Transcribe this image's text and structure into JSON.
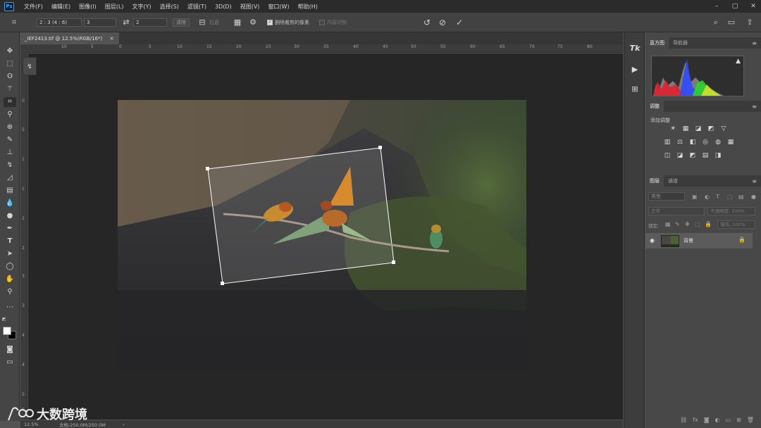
{
  "app": {
    "logo": "Ps"
  },
  "menu": [
    "文件(F)",
    "编辑(E)",
    "图像(I)",
    "图层(L)",
    "文字(Y)",
    "选择(S)",
    "滤镜(T)",
    "3D(D)",
    "视图(V)",
    "窗口(W)",
    "帮助(H)"
  ],
  "window_controls": {
    "minimize": "–",
    "restore": "▢",
    "close": "✕"
  },
  "options": {
    "ratio_value": "2 : 3 (4 : 6)",
    "width_value": "3",
    "height_value": "2",
    "clear_label": "清除",
    "straighten_label": "拉直",
    "delete_cropped_label": "删除裁剪的像素",
    "content_aware_label": "内容识别"
  },
  "document": {
    "tab_title": "_IEF2413.tif @ 12.5%(RGB/16*)",
    "tab_close": "×"
  },
  "rulers": {
    "h_ticks": [
      "10",
      "5",
      "0",
      "5",
      "10",
      "15",
      "20",
      "25",
      "30",
      "35",
      "40",
      "45",
      "50",
      "55",
      "60",
      "65",
      "70",
      "75",
      "80"
    ],
    "v_ticks": [
      "0",
      "5",
      "1",
      "1",
      "2",
      "2",
      "3",
      "3",
      "4",
      "4",
      "5",
      "5"
    ]
  },
  "status": {
    "zoom": "12.5%",
    "doc_size": "文档:250.0M/250.0M",
    "arrow": "›"
  },
  "watermark": {
    "text": "大数跨境"
  },
  "panels": {
    "histogram_tabs": [
      "直方图",
      "导航器"
    ],
    "adjustments_tab": "调整",
    "adjustments_title": "添加调整",
    "adj_row1": [
      "☀",
      "▦",
      "◪",
      "◩",
      "▽"
    ],
    "adj_row2": [
      "▥",
      "⚖",
      "◧",
      "◎",
      "◍",
      "▦"
    ],
    "adj_row3": [
      "◫",
      "◪",
      "◩",
      "▤",
      "◨"
    ],
    "layers_tabs": [
      "图层",
      "通道"
    ],
    "layer_kind": "类型",
    "blend_mode": "正常",
    "opacity_label": "不透明度: 100%",
    "lock_label": "锁定:",
    "fill_label": "填充: 100%",
    "layer_name": "背景"
  },
  "colors": {
    "accent": "#31a8ff",
    "canvas_bg": "#262627",
    "panel_bg": "#484848"
  }
}
